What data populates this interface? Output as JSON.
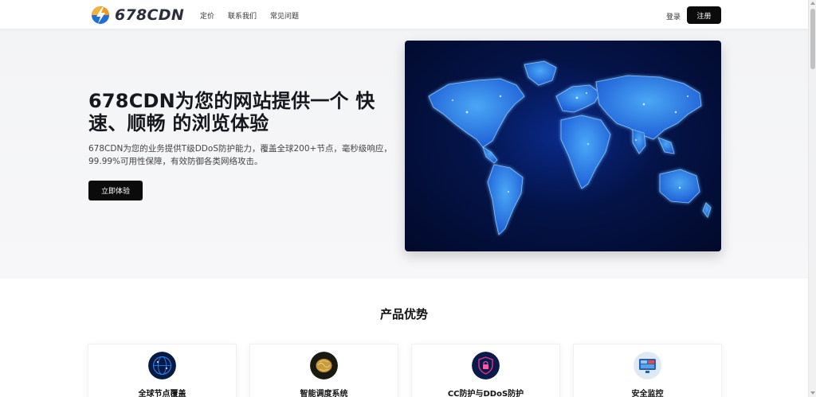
{
  "header": {
    "logo_text": "678CDN",
    "nav": [
      "定价",
      "联系我们",
      "常见问题"
    ],
    "login_label": "登录",
    "register_label": "注册"
  },
  "hero": {
    "title": "678CDN为您的网站提供一个 快速、顺畅 的浏览体验",
    "subtitle": "678CDN为您的业务提供T级DDoS防护能力，覆盖全球200+节点，毫秒级响应，99.99%可用性保障，有效防御各类网络攻击。",
    "cta_label": "立即体验",
    "image_icon": "world-map-network-image"
  },
  "features": {
    "title": "产品优势",
    "cards": [
      {
        "title": "全球节点覆盖",
        "icon": "globe-network-icon"
      },
      {
        "title": "智能调度系统",
        "icon": "ai-brain-icon"
      },
      {
        "title": "CC防护与DDoS防护",
        "icon": "shield-lock-icon"
      },
      {
        "title": "安全监控",
        "icon": "monitor-dashboard-icon"
      }
    ]
  },
  "colors": {
    "primary_button": "#0b0b0b",
    "hero_background": "#f3f4f6",
    "map_glow": "#2f8cff"
  }
}
